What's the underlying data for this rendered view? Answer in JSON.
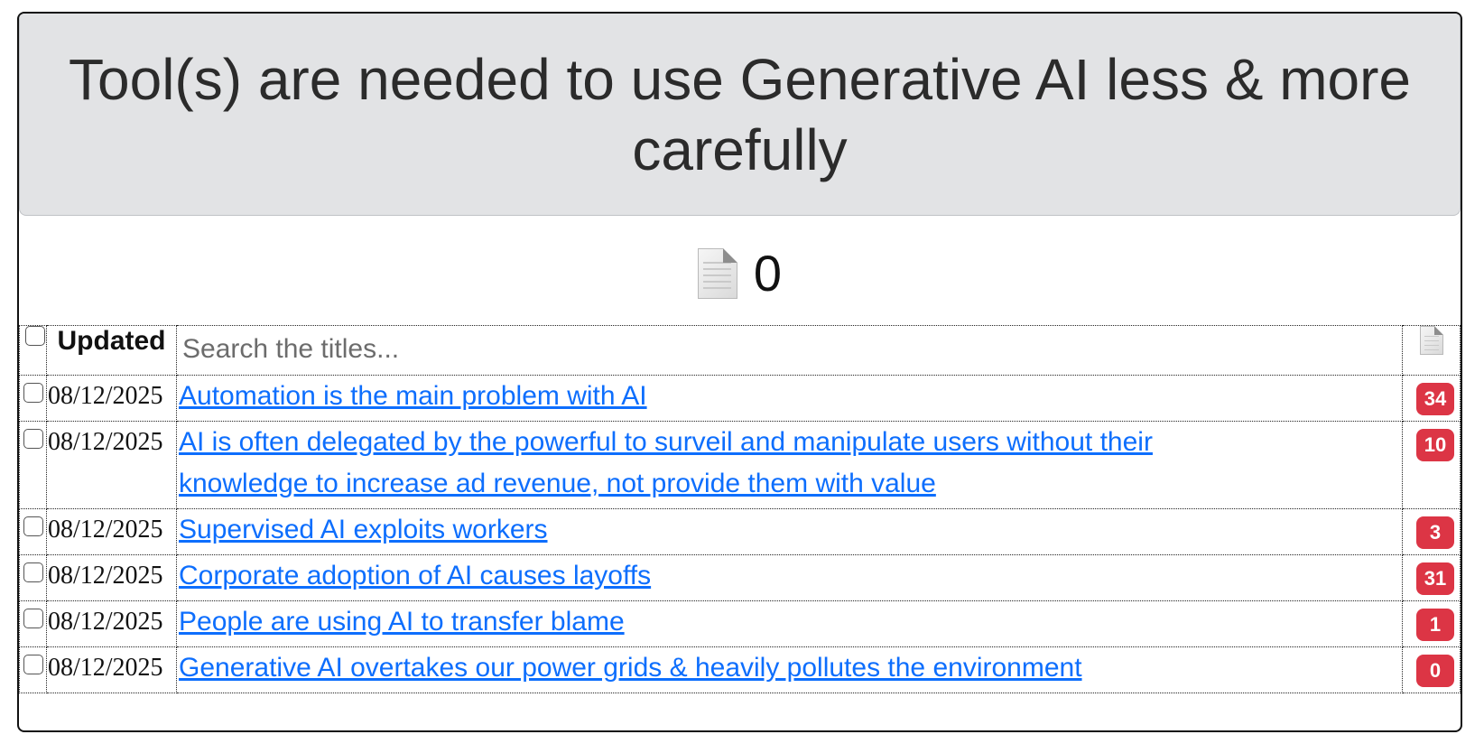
{
  "header": {
    "title": "Tool(s) are needed to use Generative AI less & more carefully"
  },
  "counter": {
    "icon": "document-icon",
    "value": "0"
  },
  "table": {
    "header": {
      "updated_label": "Updated",
      "search_placeholder": "Search the titles...",
      "icon": "document-icon"
    },
    "rows": [
      {
        "date": "08/12/2025",
        "title": "Automation is the main problem with AI",
        "count": "34"
      },
      {
        "date": "08/12/2025",
        "title": "AI is often delegated by the powerful to surveil and manipulate users without their knowledge to increase ad revenue, not provide them with value",
        "count": "10"
      },
      {
        "date": "08/12/2025",
        "title": "Supervised AI exploits workers",
        "count": "3"
      },
      {
        "date": "08/12/2025",
        "title": "Corporate adoption of AI causes layoffs",
        "count": "31"
      },
      {
        "date": "08/12/2025",
        "title": "People are using AI to transfer blame",
        "count": "1"
      },
      {
        "date": "08/12/2025",
        "title": "Generative AI overtakes our power grids & heavily pollutes the environment",
        "count": "0"
      }
    ]
  },
  "colors": {
    "header_bg": "#e2e3e5",
    "link": "#0d6efd",
    "badge": "#dc3545"
  }
}
